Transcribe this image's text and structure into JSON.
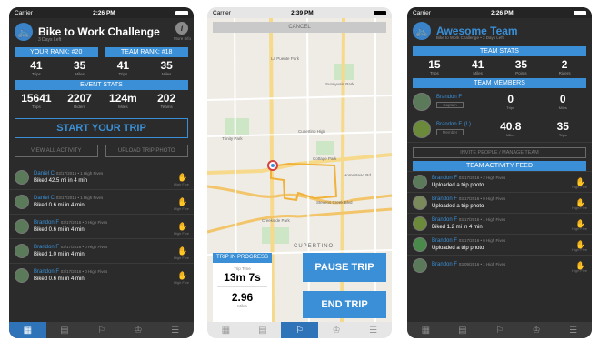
{
  "phone1": {
    "status": {
      "carrier": "Carrier",
      "time": "2:26 PM"
    },
    "header": {
      "title": "Bike to Work Challenge",
      "subtitle": "3 Days Left",
      "info_label": "More Info"
    },
    "rank": {
      "your_rank": "YOUR RANK: #20",
      "team_rank": "TEAM RANK: #18"
    },
    "rank_values": [
      {
        "value": "41",
        "label": "Trips"
      },
      {
        "value": "35",
        "label": "Miles"
      },
      {
        "value": "41",
        "label": "Trips"
      },
      {
        "value": "35",
        "label": "Miles"
      }
    ],
    "event_stats_label": "EVENT STATS",
    "event_stats": [
      {
        "value": "15641",
        "label": "Trips"
      },
      {
        "value": "2207",
        "label": "Riders"
      },
      {
        "value": "124m",
        "label": "Miles"
      },
      {
        "value": "202",
        "label": "Teams"
      }
    ],
    "start_button": "START YOUR TRIP",
    "view_activity": "VIEW ALL ACTIVITY",
    "upload_photo": "UPLOAD TRIP PHOTO",
    "feed": [
      {
        "name": "Daniel C",
        "meta": "03/17/2016 • 1 High Fives",
        "desc": "Biked 42.5 mi in 4 min"
      },
      {
        "name": "Daniel C",
        "meta": "03/17/2016 • 1 High Fives",
        "desc": "Biked 0.6 mi in 4 min"
      },
      {
        "name": "Brandon F",
        "meta": "03/17/2016 • 0 High Fives",
        "desc": "Biked 0.6 mi in 4 min"
      },
      {
        "name": "Brandon F",
        "meta": "03/17/2016 • 0 High Fives",
        "desc": "Biked 1.0 mi in 4 min"
      },
      {
        "name": "Brandon F",
        "meta": "03/17/2016 • 0 High Fives",
        "desc": "Biked 0.6 mi in 4 min"
      }
    ],
    "like_label": "High Five"
  },
  "phone2": {
    "status": {
      "carrier": "Carrier",
      "time": "2:39 PM"
    },
    "cancel": "CANCEL",
    "map_labels": [
      "La Puente Park",
      "Trinity Park",
      "Cottage Park",
      "Cupertino High",
      "Sunnyvale Park",
      "Homestead Rd",
      "Creekside Park",
      "CUPERTINO",
      "Stevens Creek Blvd"
    ],
    "trip_status": "TRIP IN PROGRESS",
    "trip_time_label": "Trip Time",
    "trip_time": "13m 7s",
    "miles_label": "Miles",
    "miles": "2.96",
    "pause_button": "PAUSE TRIP",
    "end_button": "END TRIP"
  },
  "phone3": {
    "status": {
      "carrier": "Carrier",
      "time": "2:26 PM"
    },
    "header": {
      "title": "Awesome Team",
      "subtitle": "Bike to Work Challenge • 3 Days Left"
    },
    "team_stats_label": "TEAM STATS",
    "team_stats": [
      {
        "value": "15",
        "label": "Trips"
      },
      {
        "value": "41",
        "label": "Miles"
      },
      {
        "value": "35",
        "label": "Points"
      },
      {
        "value": "2",
        "label": "Riders"
      }
    ],
    "members_label": "TEAM MEMBERS",
    "members": [
      {
        "name": "Brandon F",
        "tag": "Captain",
        "v1": "0",
        "l1": "Trips",
        "v2": "0",
        "l2": "Miles"
      },
      {
        "name": "Brandon F. (L)",
        "tag": "Member",
        "v1": "40.8",
        "l1": "Miles",
        "v2": "35",
        "l2": "Trips"
      }
    ],
    "invite_button": "INVITE PEOPLE / MANAGE TEAM",
    "activity_label": "TEAM ACTIVITY FEED",
    "feed": [
      {
        "name": "Brandon F",
        "meta": "03/17/2016 • 2 High Fives",
        "desc": "Uploaded a trip photo"
      },
      {
        "name": "Brandon F",
        "meta": "03/17/2016 • 0 High Fives",
        "desc": "Uploaded a trip photo"
      },
      {
        "name": "Brandon F",
        "meta": "03/17/2016 • 1 High Fives",
        "desc": "Biked 1.2 mi in 4 min"
      },
      {
        "name": "Brandon F",
        "meta": "03/17/2016 • 0 High Fives",
        "desc": "Uploaded a trip photo"
      },
      {
        "name": "Brandon F",
        "meta": "03/09/2016 • 1 High Fives",
        "desc": ""
      }
    ],
    "like_label": "High Five"
  },
  "colors": {
    "accent": "#3a8fd6",
    "background": "#2b2b2b",
    "tab_active": "#2f74b8"
  }
}
